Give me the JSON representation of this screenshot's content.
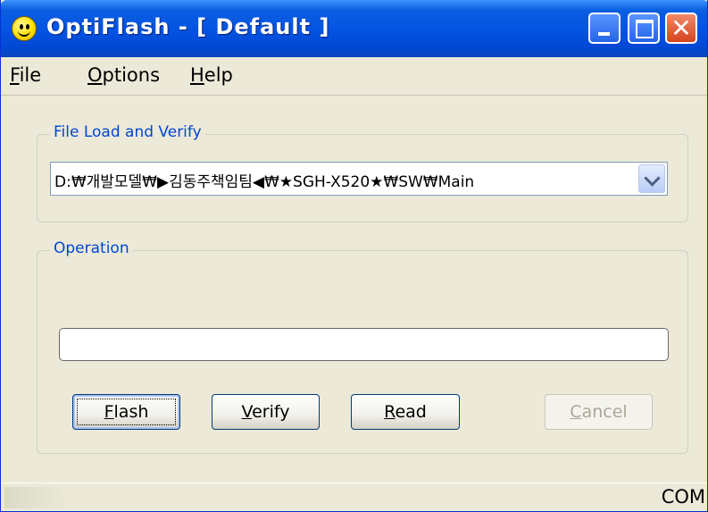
{
  "window": {
    "title": "OptiFlash - [ Default ]",
    "icon": "smiley-face-icon"
  },
  "menu": {
    "file_pre": "",
    "file_u": "F",
    "file_post": "ile",
    "options_pre": "",
    "options_u": "O",
    "options_post": "ptions",
    "help_pre": "",
    "help_u": "H",
    "help_post": "elp"
  },
  "file_load": {
    "legend": "File Load and Verify",
    "path": "D:₩개발모델₩▶김동주책임팀◀₩★SGH-X520★₩SW₩Main"
  },
  "operation": {
    "legend": "Operation",
    "progress": 0
  },
  "buttons": {
    "flash_u": "F",
    "flash_post": "lash",
    "verify_u": "V",
    "verify_post": "erify",
    "read_u": "R",
    "read_post": "ead",
    "cancel_u": "C",
    "cancel_post": "ancel"
  },
  "status": {
    "text": "COM"
  }
}
